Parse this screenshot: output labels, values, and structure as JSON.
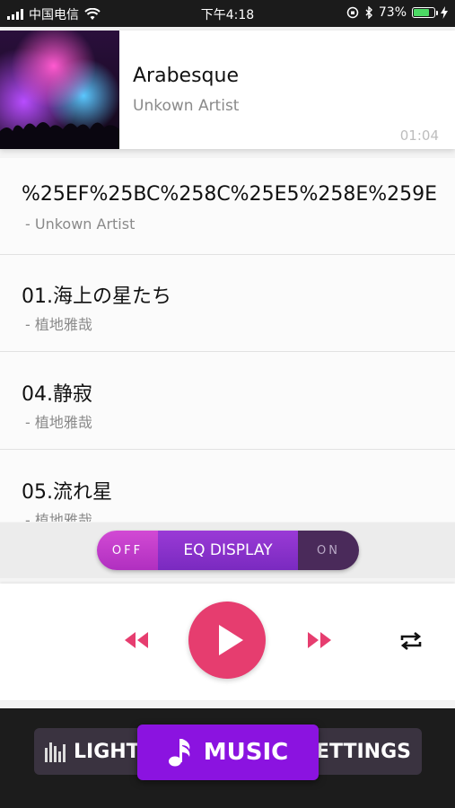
{
  "status_bar": {
    "carrier": "中国电信",
    "time": "下午4:18",
    "battery_percent": "73%"
  },
  "now_playing": {
    "title": "Arabesque",
    "artist": "Unkown Artist",
    "duration": "01:04"
  },
  "tracks": [
    {
      "title": "%25EF%25BC%258C%25E5%258E%259E",
      "artist": "- Unkown Artist"
    },
    {
      "title": "01.海上の星たち",
      "artist": "- 植地雅哉"
    },
    {
      "title": "04.静寂",
      "artist": "- 植地雅哉"
    },
    {
      "title": "05.流れ星",
      "artist": "- 植地雅哉"
    }
  ],
  "eq_toggle": {
    "off_label": "OFF",
    "center_label": "EQ DISPLAY",
    "on_label": "ON",
    "state": "off"
  },
  "player_controls": {
    "rewind_icon": "rewind-icon",
    "play_icon": "play-icon",
    "fast_forward_icon": "fast-forward-icon",
    "repeat_icon": "repeat-icon",
    "accent_color": "#e63d6f"
  },
  "tabs": {
    "light": "LIGHT",
    "music": "MUSIC",
    "settings": "SETTINGS",
    "active": "music",
    "active_color": "#8b13e0"
  }
}
